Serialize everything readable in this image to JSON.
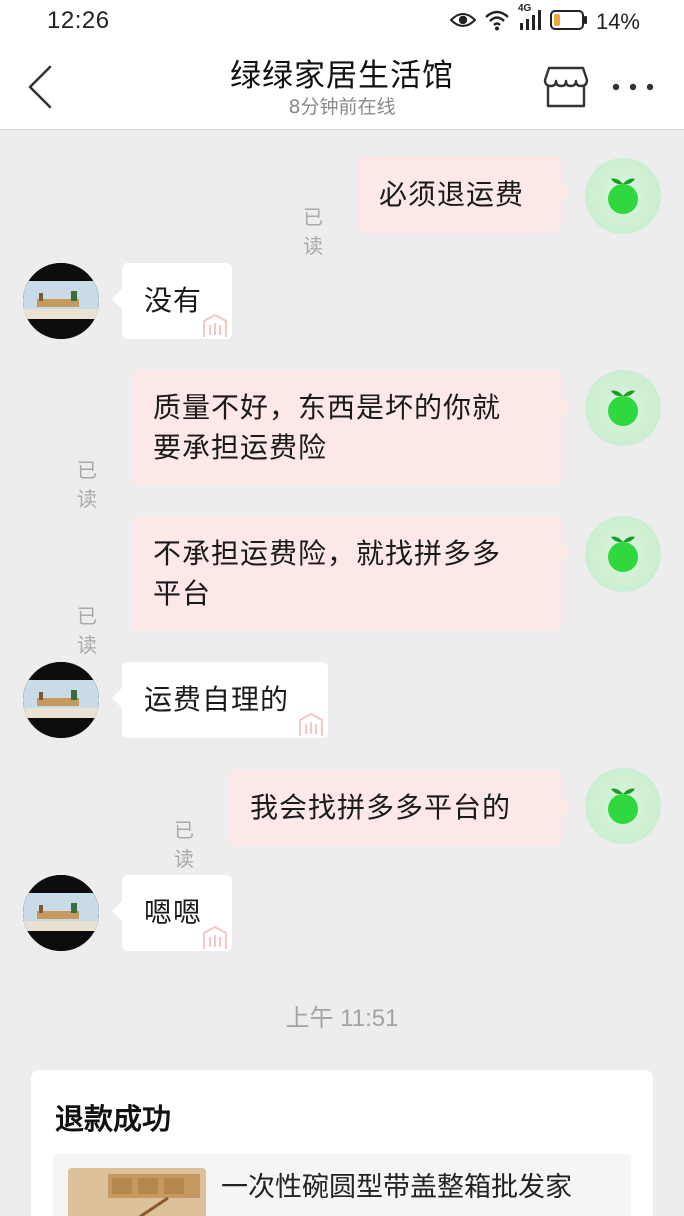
{
  "status_bar": {
    "time": "12:26",
    "battery_percent": "14%",
    "network": "4G",
    "icons": [
      "eye-icon",
      "wifi-icon",
      "signal-icon",
      "battery-icon"
    ]
  },
  "header": {
    "title": "绿绿家居生活馆",
    "subtitle": "8分钟前在线",
    "icons": [
      "back-icon",
      "shop-icon",
      "more-icon"
    ]
  },
  "messages": [
    {
      "sender": "me",
      "text": "必须退运费",
      "read": "已读"
    },
    {
      "sender": "shop",
      "text": "没有"
    },
    {
      "sender": "me",
      "lines": [
        "质量不好，东西是坏的你就",
        "要承担运费险"
      ],
      "read": "已读"
    },
    {
      "sender": "me",
      "lines": [
        "不承担运费险，就找拼多多",
        "平台"
      ],
      "read": "已读"
    },
    {
      "sender": "shop",
      "text": "运费自理的"
    },
    {
      "sender": "me",
      "text": "我会找拼多多平台的",
      "read": "已读"
    },
    {
      "sender": "shop",
      "text": "嗯嗯"
    }
  ],
  "time_divider": "上午 11:51",
  "refund_card": {
    "title": "退款成功",
    "product_name": "一次性碗圆型带盖整箱批发家"
  },
  "colors": {
    "background": "#ededed",
    "my_bubble": "#fde8e8",
    "shop_bubble": "#ffffff",
    "my_avatar_bg": "#cdefd2",
    "my_avatar_fruit": "#2fd83f",
    "read_label": "#a9a9a9"
  }
}
